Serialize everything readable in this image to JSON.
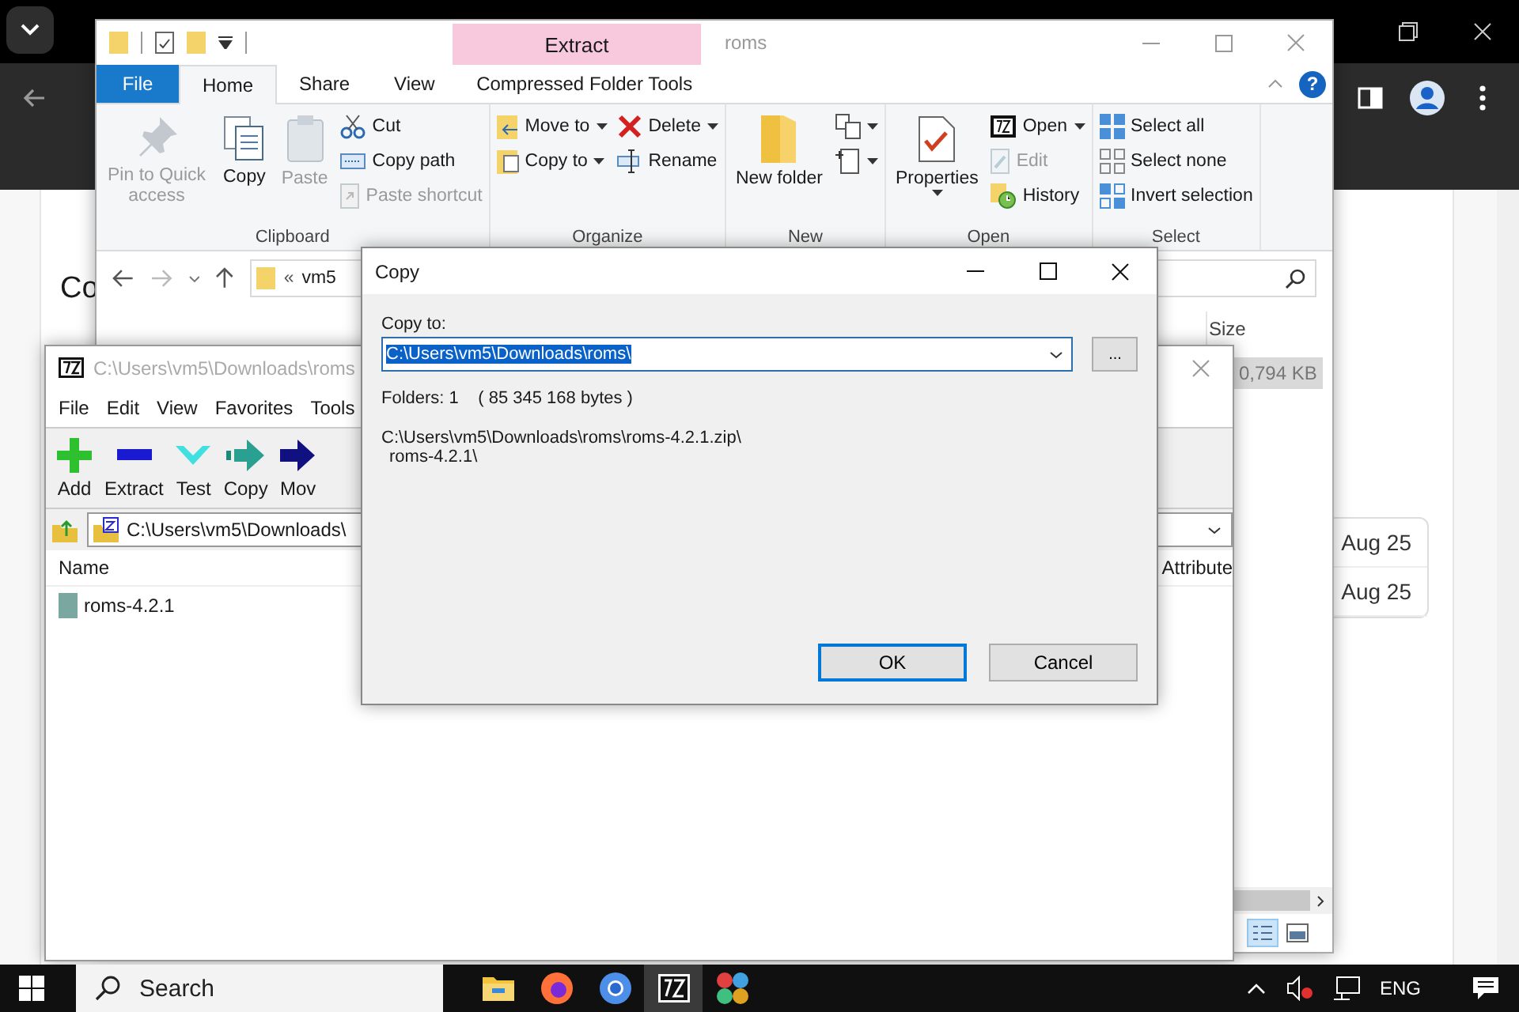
{
  "browser": {
    "heading": "Co",
    "dates": [
      "Aug 25",
      "Aug 25"
    ]
  },
  "explorer": {
    "title": "roms",
    "contextual_label": "Extract",
    "help": "?",
    "tabs": [
      {
        "label": "File",
        "kind": "file",
        "selected": false
      },
      {
        "label": "Home",
        "kind": "tab",
        "selected": true
      },
      {
        "label": "Share",
        "kind": "tab",
        "selected": false
      },
      {
        "label": "View",
        "kind": "tab",
        "selected": false
      },
      {
        "label": "Compressed Folder Tools",
        "kind": "contextual",
        "selected": false
      }
    ],
    "groups": [
      {
        "label": "Clipboard",
        "columns": [
          [
            {
              "kind": "large",
              "label": "Pin to Quick access",
              "disabled": true,
              "dropdown": false
            }
          ],
          [
            {
              "kind": "large",
              "label": "Copy",
              "disabled": false,
              "dropdown": false
            }
          ],
          [
            {
              "kind": "large",
              "label": "Paste",
              "disabled": true,
              "dropdown": false
            }
          ],
          [
            {
              "kind": "small",
              "label": "Cut",
              "disabled": false,
              "dropdown": false
            },
            {
              "kind": "small",
              "label": "Copy path",
              "disabled": false,
              "dropdown": false
            },
            {
              "kind": "small",
              "label": "Paste shortcut",
              "disabled": true,
              "dropdown": false
            }
          ]
        ]
      },
      {
        "label": "Organize",
        "columns": [
          [
            {
              "kind": "small",
              "label": "Move to",
              "disabled": false,
              "dropdown": true
            },
            {
              "kind": "small",
              "label": "Copy to",
              "disabled": false,
              "dropdown": true
            }
          ],
          [
            {
              "kind": "small",
              "label": "Delete",
              "disabled": false,
              "dropdown": true
            },
            {
              "kind": "small",
              "label": "Rename",
              "disabled": false,
              "dropdown": false
            }
          ]
        ]
      },
      {
        "label": "New",
        "columns": [
          [
            {
              "kind": "large",
              "label": "New folder",
              "disabled": false,
              "dropdown": false
            }
          ],
          [
            {
              "kind": "small",
              "disabled": false,
              "dropdown": true
            },
            {
              "kind": "small",
              "disabled": false,
              "dropdown": true
            }
          ]
        ]
      },
      {
        "label": "Open",
        "columns": [
          [
            {
              "kind": "large",
              "label": "Properties",
              "disabled": false,
              "dropdown": true
            }
          ],
          [
            {
              "kind": "small",
              "label": "Open",
              "disabled": false,
              "dropdown": true
            },
            {
              "kind": "small",
              "label": "Edit",
              "disabled": true,
              "dropdown": false
            },
            {
              "kind": "small",
              "label": "History",
              "disabled": false,
              "dropdown": false
            }
          ]
        ]
      },
      {
        "label": "Select",
        "columns": [
          [
            {
              "kind": "small",
              "label": "Select all",
              "disabled": false,
              "dropdown": false
            },
            {
              "kind": "small",
              "label": "Select none",
              "disabled": false,
              "dropdown": false
            },
            {
              "kind": "small",
              "label": "Invert selection",
              "disabled": false,
              "dropdown": false
            }
          ]
        ]
      }
    ],
    "address": {
      "prefix": "«",
      "path": "vm5"
    },
    "columns": [
      "Size"
    ],
    "rows": [
      {
        "size": "0,794 KB",
        "selected": true
      }
    ]
  },
  "sevenzip": {
    "title": "C:\\Users\\vm5\\Downloads\\roms",
    "menu": [
      "File",
      "Edit",
      "View",
      "Favorites",
      "Tools"
    ],
    "toolbar": [
      "Add",
      "Extract",
      "Test",
      "Copy",
      "Mov"
    ],
    "address": "C:\\Users\\vm5\\Downloads\\",
    "columns": [
      "Name",
      "Attribute"
    ],
    "rows": [
      {
        "name": "roms-4.2.1",
        "selected": false
      }
    ]
  },
  "copy_dialog": {
    "title": "Copy",
    "label": "Copy to:",
    "path": "C:\\Users\\vm5\\Downloads\\roms\\",
    "browse": "...",
    "info": "Folders: 1    ( 85 345 168 bytes )",
    "source": [
      "C:\\Users\\vm5\\Downloads\\roms\\roms-4.2.1.zip\\",
      "roms-4.2.1\\"
    ],
    "buttons": [
      {
        "label": "OK",
        "default": true
      },
      {
        "label": "Cancel",
        "default": false
      }
    ]
  },
  "taskbar": {
    "search": "Search",
    "apps": [
      {
        "selected": false
      },
      {
        "selected": false
      },
      {
        "selected": false
      },
      {
        "selected": true
      },
      {
        "selected": false
      }
    ],
    "language": "ENG"
  }
}
